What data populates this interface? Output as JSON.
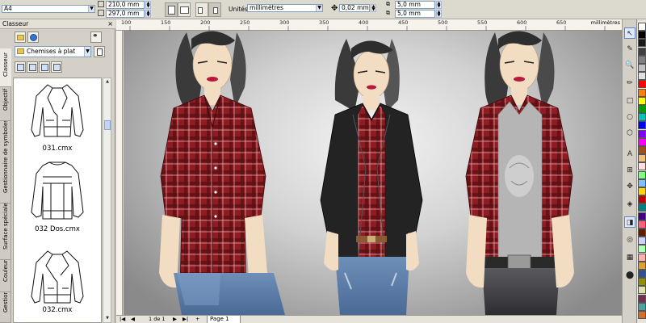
{
  "property_bar": {
    "paper_size": "A4",
    "width": "210,0 mm",
    "height": "297,0 mm",
    "units_label": "Unités :",
    "units_value": "millimètres",
    "nudge": "0,02 mm",
    "dup_x": "5,0 mm",
    "dup_y": "5,0 mm"
  },
  "docker": {
    "title": "Classeur",
    "close_glyph": "×",
    "folder": "Chemises à plat",
    "tabs": [
      "Classeur",
      "Objectif",
      "Gestionnaire de symboles",
      "Surface spéciale",
      "Couleur",
      "Gestionnai..."
    ],
    "items": [
      {
        "label": "031.cmx"
      },
      {
        "label": "032 Dos.cmx"
      },
      {
        "label": "032.cmx"
      }
    ]
  },
  "ruler": {
    "top_ticks": [
      "100",
      "150",
      "200",
      "250",
      "300",
      "350",
      "400",
      "450",
      "500",
      "550",
      "600",
      "650",
      "700"
    ],
    "unit": "millimètres"
  },
  "page_nav": {
    "first": "|◀",
    "prev": "◀",
    "counter": "1 de 1",
    "next": "▶",
    "last": "▶|",
    "add": "+",
    "page_tab": "Page 1"
  },
  "toolbox": {
    "tools": [
      "↖",
      "✎",
      "🔍",
      "✏",
      "□",
      "○",
      "⬡",
      "A",
      "⊞",
      "✥",
      "◈",
      "◨",
      "◎",
      "▦",
      "⬤"
    ],
    "active_tool": 0
  },
  "colors": {
    "chrome": "#d4d0c8",
    "plaid_red": "#8e1c22",
    "jeans": "#5b7ea8",
    "blazer": "#232323"
  },
  "palette": [
    "#ffffff",
    "#000000",
    "#1a1a1a",
    "#404040",
    "#808080",
    "#c0c0c0",
    "#e0e0e0",
    "#ff0000",
    "#ff8000",
    "#ffff00",
    "#00a000",
    "#00c0c0",
    "#0000ff",
    "#8000ff",
    "#ff00ff",
    "#a05020",
    "#f0c080",
    "#ffe0e0",
    "#80ff80",
    "#80c0ff",
    "#ffd700",
    "#c00000",
    "#008080",
    "#400080",
    "#ff6080",
    "#602000",
    "#d0d0ff",
    "#b0ffb0",
    "#ffb0b0",
    "#e0a030",
    "#305090",
    "#909000",
    "#e0e0b0",
    "#703050",
    "#50a0a0",
    "#d07030"
  ]
}
